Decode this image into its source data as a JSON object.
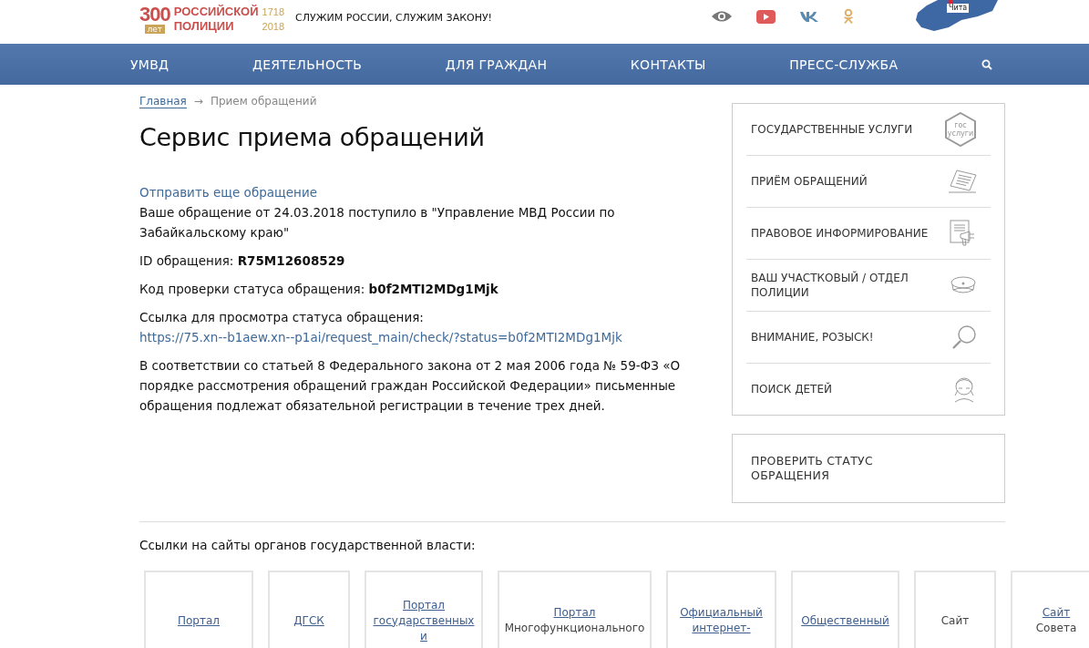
{
  "header": {
    "logo": {
      "number": "300",
      "years_word": "лет",
      "line1": "РОССИЙСКОЙ",
      "line2": "ПОЛИЦИИ",
      "year_start": "1718",
      "year_end": "2018"
    },
    "slogan": "СЛУЖИМ РОССИИ, СЛУЖИМ ЗАКОНУ!",
    "map_label": "Чита"
  },
  "nav": [
    "УМВД",
    "ДЕЯТЕЛЬНОСТЬ",
    "ДЛЯ ГРАЖДАН",
    "КОНТАКТЫ",
    "ПРЕСС-СЛУЖБА"
  ],
  "breadcrumbs": {
    "home": "Главная",
    "separator": "→",
    "current": "Прием обращений"
  },
  "title": "Сервис приема обращений",
  "send_again_link": "Отправить еще обращение",
  "received_text": "Ваше обращение от 24.03.2018 поступило в \"Управление МВД России по Забайкальскому краю\"",
  "id_text": "ID обращения: **R75M12608529**",
  "code_text": "Код проверки статуса обращения: **b0f2MTI2MDg1Mjk**",
  "status_link": {
    "label": "Ссылка для просмотра статуса обращения:",
    "url": "https://75.xn--b1aew.xn--p1ai/request_main/check/?status=b0f2MTI2MDg1Mjk"
  },
  "law_text": "В соответствии со статьей 8 Федерального закона от 2 мая 2006 года № 59-ФЗ «О порядке рассмотрения обращений граждан Российской Федерации» письменные обращения подлежат обязательной регистрации в течение трех дней.",
  "sidebar": [
    {
      "label": "ГОСУДАРСТВЕННЫЕ УСЛУГИ",
      "kind": "gosuslugi",
      "icon_lines": [
        "гос",
        "услуги"
      ]
    },
    {
      "label": "ПРИЁМ ОБРАЩЕНИЙ",
      "kind": "document"
    },
    {
      "label": "ПРАВОВОЕ ИНФОРМИРОВАНИЕ",
      "kind": "info"
    },
    {
      "label": "ВАШ УЧАСТКОВЫЙ / ОТДЕЛ ПОЛИЦИИ",
      "kind": "cap"
    },
    {
      "label": "ВНИМАНИЕ, РОЗЫСК!",
      "kind": "search"
    },
    {
      "label": "ПОИСК ДЕТЕЙ",
      "kind": "child"
    }
  ],
  "status_check": "ПРОВЕРИТЬ СТАТУС ОБРАЩЕНИЯ",
  "links_heading": "Ссылки на сайты органов государственной власти:",
  "link_cards": [
    {
      "lines": [
        {
          "text": "Портал",
          "link": true
        }
      ]
    },
    {
      "lines": [
        {
          "text": "ДГСК",
          "link": true
        }
      ]
    },
    {
      "lines": [
        {
          "text": "Портал",
          "link": true
        },
        {
          "text": "государственных",
          "link": true
        },
        {
          "text": "и",
          "link": true
        }
      ]
    },
    {
      "lines": [
        {
          "text": "Портал",
          "link": true
        },
        {
          "text": "Многофункционального",
          "link": false
        }
      ]
    },
    {
      "lines": [
        {
          "text": "Официальный",
          "link": true
        },
        {
          "text": "интернет-",
          "link": true
        }
      ]
    },
    {
      "lines": [
        {
          "text": "Общественный",
          "link": true
        }
      ]
    },
    {
      "lines": [
        {
          "text": "Сайт",
          "link": false
        }
      ]
    },
    {
      "lines": [
        {
          "text": "Сайт",
          "link": true
        },
        {
          "text": "Совета",
          "link": false
        }
      ]
    }
  ]
}
